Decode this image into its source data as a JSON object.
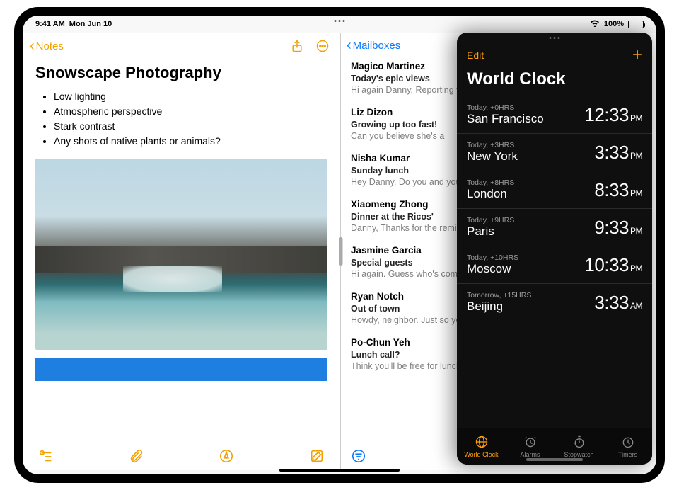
{
  "status": {
    "time": "9:41 AM",
    "date": "Mon Jun 10",
    "battery": "100%"
  },
  "notes": {
    "back_label": "Notes",
    "title": "Snowscape Photography",
    "bullets": [
      "Low lighting",
      "Atmospheric perspective",
      "Stark contrast",
      "Any shots of native plants or animals?"
    ]
  },
  "mail": {
    "back_label": "Mailboxes",
    "items": [
      {
        "from": "Magico Martinez",
        "subject": "Today's epic views",
        "preview": "Hi again Danny, Reporting from the field. Wide open skies, a ger"
      },
      {
        "from": "Liz Dizon",
        "subject": "Growing up too fast!",
        "preview": "Can you believe she's a"
      },
      {
        "from": "Nisha Kumar",
        "subject": "Sunday lunch",
        "preview": "Hey Danny, Do you and your dad? If you two join, th"
      },
      {
        "from": "Xiaomeng Zhong",
        "subject": "Dinner at the Ricos'",
        "preview": "Danny, Thanks for the reminder — remembered to take or"
      },
      {
        "from": "Jasmine Garcia",
        "subject": "Special guests",
        "preview": "Hi again. Guess who's coming — know how to make me"
      },
      {
        "from": "Ryan Notch",
        "subject": "Out of town",
        "preview": "Howdy, neighbor. Just so you know I'm leaving Tuesday and"
      },
      {
        "from": "Po-Chun Yeh",
        "subject": "Lunch call?",
        "preview": "Think you'll be free for lunch — you think might work a"
      }
    ]
  },
  "clock": {
    "edit": "Edit",
    "title": "World Clock",
    "rows": [
      {
        "meta": "Today, +0HRS",
        "city": "San Francisco",
        "time": "12:33",
        "ampm": "PM"
      },
      {
        "meta": "Today, +3HRS",
        "city": "New York",
        "time": "3:33",
        "ampm": "PM"
      },
      {
        "meta": "Today, +8HRS",
        "city": "London",
        "time": "8:33",
        "ampm": "PM"
      },
      {
        "meta": "Today, +9HRS",
        "city": "Paris",
        "time": "9:33",
        "ampm": "PM"
      },
      {
        "meta": "Today, +10HRS",
        "city": "Moscow",
        "time": "10:33",
        "ampm": "PM"
      },
      {
        "meta": "Tomorrow, +15HRS",
        "city": "Beijing",
        "time": "3:33",
        "ampm": "AM"
      }
    ],
    "tabs": [
      {
        "label": "World Clock",
        "icon": "globe"
      },
      {
        "label": "Alarms",
        "icon": "alarm"
      },
      {
        "label": "Stopwatch",
        "icon": "stopwatch"
      },
      {
        "label": "Timers",
        "icon": "timer"
      }
    ]
  }
}
